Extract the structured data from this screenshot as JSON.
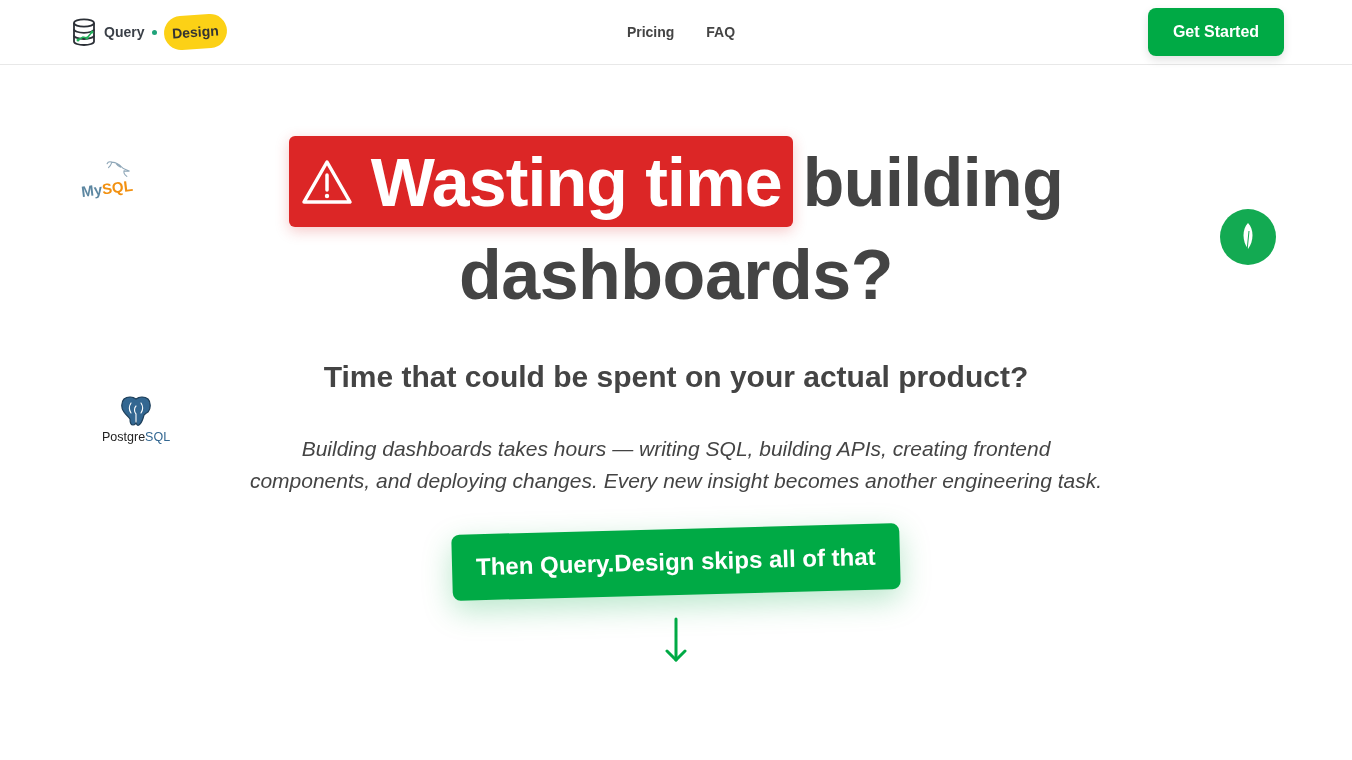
{
  "header": {
    "logo": {
      "word_1": "Query",
      "word_2": "Design"
    },
    "nav_links": [
      {
        "label": "Pricing"
      },
      {
        "label": "FAQ"
      }
    ],
    "cta_button": {
      "label": "Get Started"
    }
  },
  "hero": {
    "headline": {
      "highlight": "Wasting time",
      "lines": [
        "building",
        "dashboards?"
      ]
    },
    "subtitle": "Time that could be spent on your actual product?",
    "description": "Building dashboards takes hours — writing SQL, building APIs, creating frontend components, and deploying changes. Every new insight becomes another engineering task.",
    "callout": "Then Query.Design skips all of that"
  },
  "floating_logos": [
    {
      "kind": "mysql",
      "text_parts": [
        "My",
        "SQL"
      ]
    },
    {
      "kind": "postgresql",
      "text_parts": [
        "Postgre",
        "SQL"
      ]
    },
    {
      "kind": "mongodb"
    }
  ]
}
